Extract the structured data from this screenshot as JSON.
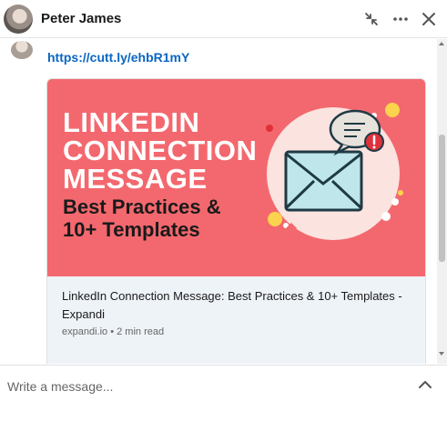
{
  "header": {
    "contact_name": "Peter James",
    "icons": {
      "minimize": "compress-icon",
      "more": "more-horizontal-icon",
      "close": "close-icon"
    }
  },
  "message": {
    "link_text": "https://cutt.ly/ehbR1mY"
  },
  "link_preview": {
    "image_headline_lines": [
      "LINKEDIN",
      "CONNECTION",
      "MESSAGE"
    ],
    "image_subline_lines": [
      "Best Practices &",
      "10+ Templates"
    ],
    "title": "LinkedIn Connection Message: Best Practices & 10+ Templates - Expandi",
    "meta": "expandi.io • 2 min read",
    "image_colors": {
      "background": "#f3686e",
      "circle": "#fbe3df",
      "envelope": "#bfe6ea",
      "alert": "#e0303a",
      "dot_yellow": "#fcd34d"
    }
  },
  "composer": {
    "placeholder": "Write a message...",
    "expand_icon": "chevron-up-icon"
  }
}
